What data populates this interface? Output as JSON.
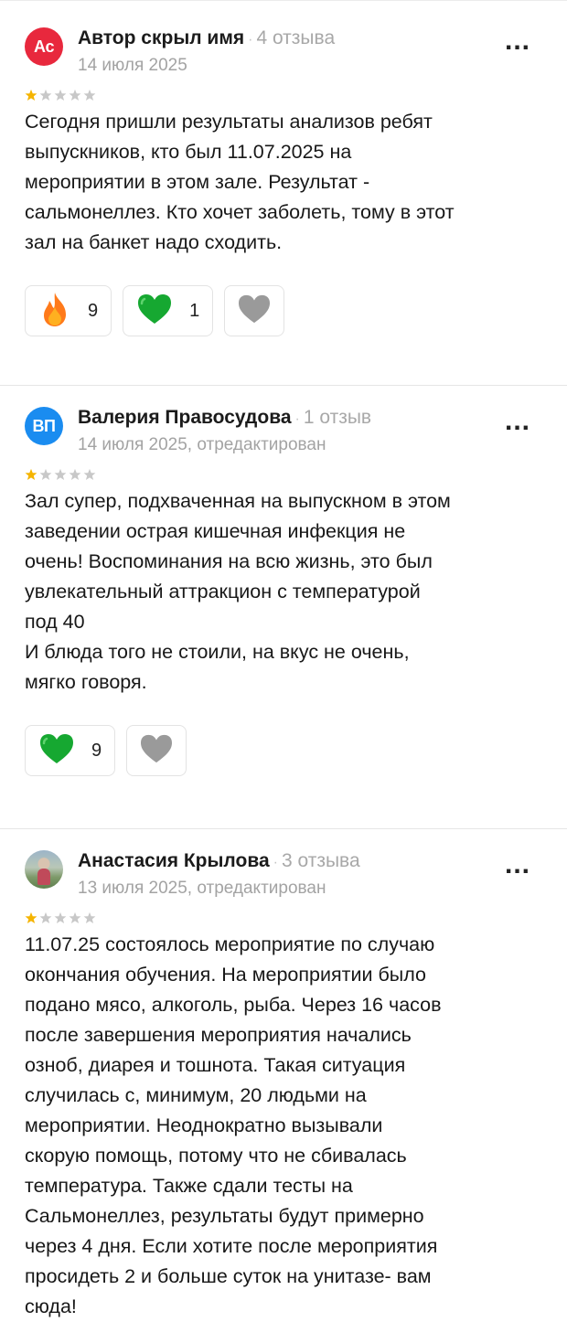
{
  "reviews": [
    {
      "avatar_text": "Ac",
      "avatar_color": "#e8283d",
      "author": "Автор скрыл имя",
      "review_count": "4 отзыва",
      "date": "14 июля 2025",
      "rating": 1,
      "max_rating": 5,
      "text": "Сегодня пришли результаты анализов ребят\nвыпускников, кто был 11.07.2025 на\nмероприятии в этом зале. Результат -\nсальмонеллез. Кто хочет заболеть, тому в этот\nзал на банкет надо сходить.",
      "reactions": {
        "fire": "9",
        "green_heart": "1"
      }
    },
    {
      "avatar_text": "ВП",
      "avatar_color": "#1a8cf0",
      "author": "Валерия Правосудова",
      "review_count": "1 отзыв",
      "date": "14 июля 2025, отредактирован",
      "rating": 1,
      "max_rating": 5,
      "text": "Зал супер, подхваченная на выпускном в этом\nзаведении острая кишечная инфекция не\nочень! Воспоминания на всю жизнь, это был\nувлекательный аттракцион с температурой\nпод 40\nИ блюда того не стоили, на вкус не очень,\nмягко говоря.",
      "reactions": {
        "green_heart": "9"
      }
    },
    {
      "author": "Анастасия Крылова",
      "review_count": "3 отзыва",
      "date": "13 июля 2025, отредактирован",
      "rating": 1,
      "max_rating": 5,
      "text": "11.07.25 состоялось мероприятие по случаю\nокончания обучения. На мероприятии было\nподано мясо, алкоголь, рыба. Через 16 часов\nпосле завершения мероприятия начались\nозноб, диарея и тошнота. Такая ситуация\nслучилась с, минимум, 20 людьми на\nмероприятии. Неоднократно вызывали\nскорую помощь, потому что не сбивалась\nтемпература. Также сдали тесты на\nСальмонеллез, результаты будут примерно\nчерез 4 дня. Если хотите после мероприятия\nпросидеть 2 и больше суток на унитазе- вам\nсюда!"
    }
  ],
  "more_glyph": "...",
  "dot_glyph": "·",
  "colors": {
    "star_filled": "#f5b400",
    "star_empty": "#c8c8c8",
    "heart_green": "#16a831",
    "heart_gray": "#9a9a9a",
    "fire": "#ff7a1a"
  }
}
